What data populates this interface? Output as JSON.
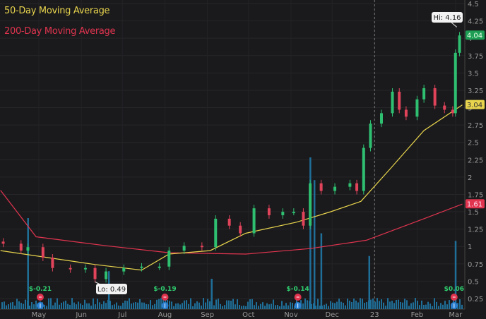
{
  "legend": {
    "ma50_label": "50-Day Moving Average",
    "ma200_label": "200-Day Moving Average"
  },
  "colors": {
    "background": "#1a1a1c",
    "up": "#2fbf71",
    "down": "#e0435a",
    "ma50": "#e8d44d",
    "ma200": "#e0344f",
    "volume": "#1f6f99",
    "earnings_marker": "#e0344f",
    "dividend_marker": "#2a7fd0"
  },
  "chart_data": {
    "type": "candlestick",
    "y_axis": {
      "position": "right",
      "range": [
        0.15,
        4.5
      ],
      "ticks": [
        "0.25",
        "0.5",
        "0.75",
        "1",
        "1.25",
        "1.5",
        "1.75",
        "2",
        "2.25",
        "2.5",
        "2.75",
        "3",
        "3.25",
        "3.5",
        "3.75",
        "4",
        "4.25",
        "4.5"
      ]
    },
    "x_axis": {
      "range": [
        "2022-04-03",
        "2023-03-06"
      ],
      "ticks": [
        {
          "label": "May",
          "date": "2022-05-01"
        },
        {
          "label": "Jun",
          "date": "2022-06-01"
        },
        {
          "label": "Jul",
          "date": "2022-07-01"
        },
        {
          "label": "Aug",
          "date": "2022-08-01"
        },
        {
          "label": "Sep",
          "date": "2022-09-01"
        },
        {
          "label": "Oct",
          "date": "2022-10-01"
        },
        {
          "label": "Nov",
          "date": "2022-11-01"
        },
        {
          "label": "Dec",
          "date": "2022-12-01"
        },
        {
          "label": "23",
          "date": "2023-01-01"
        },
        {
          "label": "Feb",
          "date": "2023-02-01"
        },
        {
          "label": "Mar",
          "date": "2023-03-01"
        }
      ]
    },
    "year_divider": "2023-01-01",
    "grid": true,
    "price": {
      "dates": [
        "2022-04-05",
        "2022-04-18",
        "2022-04-23",
        "2022-05-04",
        "2022-05-11",
        "2022-05-24",
        "2022-06-04",
        "2022-06-11",
        "2022-06-19",
        "2022-07-02",
        "2022-07-15",
        "2022-07-28",
        "2022-08-04",
        "2022-08-15",
        "2022-08-28",
        "2022-09-07",
        "2022-09-17",
        "2022-09-25",
        "2022-10-05",
        "2022-10-16",
        "2022-10-26",
        "2022-11-03",
        "2022-11-10",
        "2022-11-15",
        "2022-11-23",
        "2022-12-03",
        "2022-12-14",
        "2022-12-19",
        "2022-12-24",
        "2022-12-29",
        "2023-01-06",
        "2023-01-14",
        "2023-01-19",
        "2023-01-24",
        "2023-02-01",
        "2023-02-06",
        "2023-02-14",
        "2023-02-21",
        "2023-02-27",
        "2023-03-01",
        "2023-03-04"
      ],
      "close": [
        1.04,
        0.94,
        0.99,
        0.84,
        0.69,
        0.67,
        0.69,
        0.53,
        0.64,
        0.69,
        0.71,
        0.71,
        0.94,
        1.01,
        0.99,
        1.4,
        1.3,
        1.19,
        1.55,
        1.45,
        1.5,
        1.5,
        1.3,
        1.91,
        1.8,
        1.86,
        1.91,
        1.8,
        2.42,
        2.77,
        2.92,
        3.23,
        2.97,
        2.87,
        3.12,
        3.28,
        3.03,
        2.97,
        2.92,
        3.79,
        4.04
      ]
    },
    "ma50": {
      "name": "50-Day Moving Average",
      "dates": [
        "2022-04-03",
        "2022-06-11",
        "2022-07-15",
        "2022-08-04",
        "2022-09-03",
        "2022-09-29",
        "2022-11-05",
        "2022-11-30",
        "2022-12-22",
        "2023-01-12",
        "2023-02-06",
        "2023-03-06"
      ],
      "values": [
        0.94,
        0.74,
        0.66,
        0.89,
        0.94,
        1.19,
        1.35,
        1.5,
        1.65,
        2.11,
        2.67,
        3.04
      ]
    },
    "ma200": {
      "name": "200-Day Moving Average",
      "dates": [
        "2022-04-03",
        "2022-04-29",
        "2022-06-19",
        "2022-08-04",
        "2022-09-29",
        "2022-11-15",
        "2022-12-26",
        "2023-02-06",
        "2023-03-06"
      ],
      "values": [
        1.81,
        1.14,
        1.01,
        0.91,
        0.89,
        0.97,
        1.09,
        1.4,
        1.61
      ]
    },
    "volume_relative": {
      "dates": [
        "2022-04-23",
        "2022-06-21",
        "2022-09-04",
        "2022-11-15",
        "2022-11-18",
        "2022-11-23",
        "2022-12-28",
        "2023-03-01"
      ],
      "values": [
        0.6,
        0.25,
        0.2,
        1.0,
        0.85,
        0.5,
        0.35,
        0.45
      ]
    },
    "annotations": {
      "high": "Hi: 4.16",
      "low": "Lo: 0.49",
      "high_date": "2023-03-02",
      "high_value": 4.16,
      "low_date": "2022-06-11",
      "low_value": 0.49
    },
    "price_tags": {
      "last": "4.04",
      "ma50": "3.04",
      "ma200": "1.61"
    },
    "events": [
      {
        "date": "2022-05-02",
        "eps": "$-0.21"
      },
      {
        "date": "2022-08-01",
        "eps": "$-0.19"
      },
      {
        "date": "2022-11-06",
        "eps": "$-0.14"
      },
      {
        "date": "2023-02-28",
        "eps": "$0.06"
      }
    ]
  }
}
